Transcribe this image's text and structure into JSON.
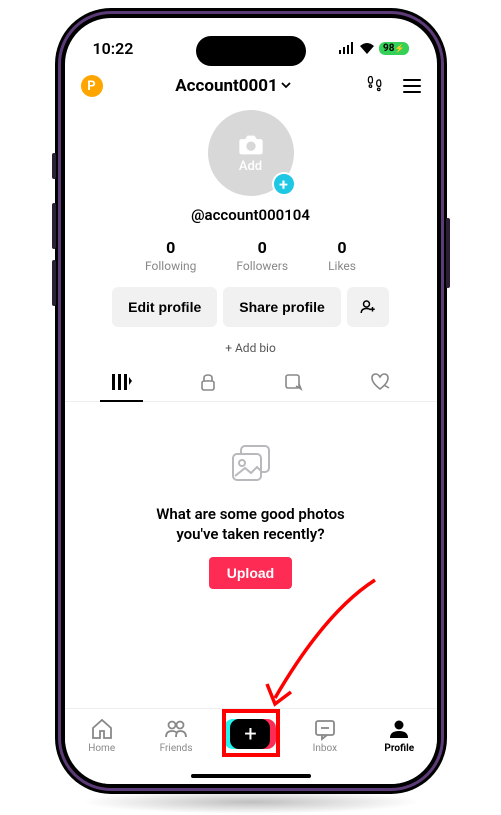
{
  "status": {
    "time": "10:22",
    "battery": "98"
  },
  "header": {
    "badge": "P",
    "title": "Account0001"
  },
  "avatar": {
    "add_label": "Add"
  },
  "profile": {
    "username": "@account000104"
  },
  "stats": {
    "following": {
      "value": "0",
      "label": "Following"
    },
    "followers": {
      "value": "0",
      "label": "Followers"
    },
    "likes": {
      "value": "0",
      "label": "Likes"
    }
  },
  "actions": {
    "edit": "Edit profile",
    "share": "Share profile"
  },
  "bio": {
    "add": "+ Add bio"
  },
  "empty": {
    "line1": "What are some good photos",
    "line2": "you've taken recently?",
    "upload": "Upload"
  },
  "nav": {
    "home": "Home",
    "friends": "Friends",
    "inbox": "Inbox",
    "profile": "Profile"
  }
}
